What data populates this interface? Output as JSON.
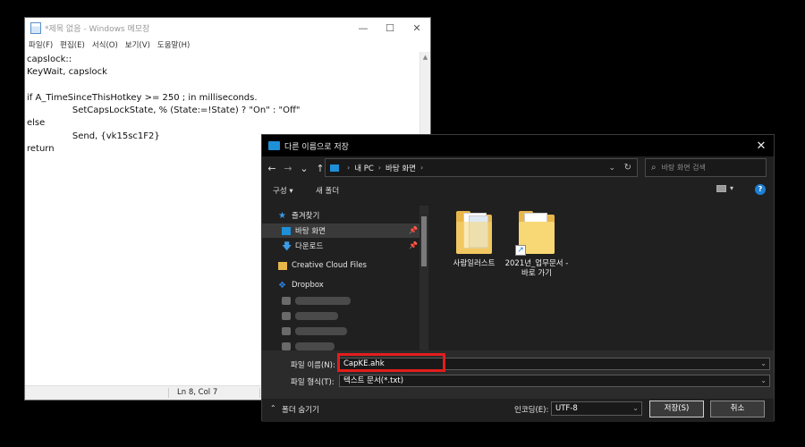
{
  "notepad": {
    "title": "*제목 없음 - Windows 메모장",
    "menu": [
      "파일(F)",
      "편집(E)",
      "서식(O)",
      "보기(V)",
      "도움말(H)"
    ],
    "text": "capslock::\nKeyWait, capslock\n\nif A_TimeSinceThisHotkey >= 250 ; in milliseconds.\n\t\tSetCapsLockState, % (State:=!State) ? \"On\" : \"Off\"\nelse\n\t\tSend, {vk15sc1F2}\nreturn",
    "status_position": "Ln 8, Col 7",
    "controls": {
      "minimize": "—",
      "maximize": "☐",
      "close": "✕"
    }
  },
  "dialog": {
    "title": "다른 이름으로 저장",
    "close": "✕",
    "nav": {
      "back": "←",
      "forward": "→",
      "recent": "⌄",
      "up": "↑"
    },
    "breadcrumb": [
      "내 PC",
      "바탕 화면"
    ],
    "search_placeholder": "바탕 화면 검색",
    "toolbar": {
      "organize": "구성 ▾",
      "new_folder": "새 폴더",
      "help": "?"
    },
    "nav_pane": {
      "quick_access": "즐겨찾기",
      "desktop": "바탕 화면",
      "downloads": "다운로드",
      "creative_cloud": "Creative Cloud Files",
      "dropbox": "Dropbox"
    },
    "files": [
      {
        "name": "사람일러스트"
      },
      {
        "name": "2021년_업무문서 - 바로 가기"
      }
    ],
    "filename_label": "파일 이름(N):",
    "filename_value": "CapKE.ahk",
    "filetype_label": "파일 형식(T):",
    "filetype_value": "텍스트 문서(*.txt)",
    "hide_folders": "폴더 숨기기",
    "encoding_label": "인코딩(E):",
    "encoding_value": "UTF-8",
    "save_button": "저장(S)",
    "cancel_button": "취소"
  },
  "colors": {
    "highlight": "#e31d1d",
    "accent": "#1e90d8"
  }
}
